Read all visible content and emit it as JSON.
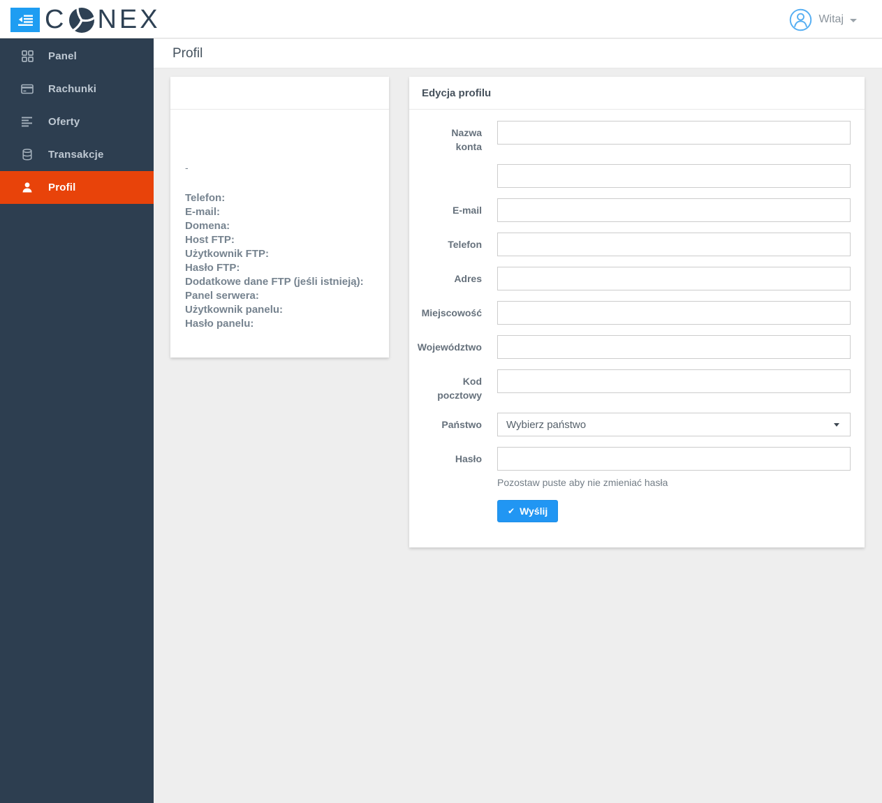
{
  "header": {
    "brand_prefix": "C",
    "brand_suffix": "NEX",
    "greeting": "Witaj"
  },
  "sidebar": {
    "items": [
      {
        "label": "Panel",
        "icon": "grid-icon",
        "active": false
      },
      {
        "label": "Rachunki",
        "icon": "credit-card-icon",
        "active": false
      },
      {
        "label": "Oferty",
        "icon": "list-icon",
        "active": false
      },
      {
        "label": "Transakcje",
        "icon": "database-icon",
        "active": false
      },
      {
        "label": "Profil",
        "icon": "user-icon",
        "active": true
      }
    ]
  },
  "page": {
    "title": "Profil"
  },
  "profile_card": {
    "placeholder_dash": "-",
    "labels": [
      "Telefon:",
      "E-mail:",
      "Domena:",
      "Host FTP:",
      "Użytkownik FTP:",
      "Hasło FTP:",
      "Dodatkowe dane FTP (jeśli istnieją):",
      "Panel serwera:",
      "Użytkownik panelu:",
      "Hasło panelu:"
    ]
  },
  "edit_card": {
    "title": "Edycja profilu",
    "rows": [
      {
        "label": "Nazwa\nkonta",
        "type": "text"
      },
      {
        "label": "",
        "type": "text"
      },
      {
        "label": "E-mail",
        "type": "text"
      },
      {
        "label": "Telefon",
        "type": "text"
      },
      {
        "label": "Adres",
        "type": "text"
      },
      {
        "label": "Miejscowość",
        "type": "text"
      },
      {
        "label": "Województwo",
        "type": "text"
      },
      {
        "label": "Kod\npocztowy",
        "type": "text"
      },
      {
        "label": "Państwo",
        "type": "select",
        "select_value": "Wybierz państwo"
      },
      {
        "label": "Hasło",
        "type": "password",
        "help": "Pozostaw puste aby nie zmieniać hasła"
      }
    ],
    "submit_label": "Wyślij",
    "submit_icon": "check-icon"
  },
  "colors": {
    "sidebar_bg": "#2d3e50",
    "active_orange": "#e8430a",
    "toggle_blue": "#1e9df2",
    "button_blue": "#2196f3",
    "content_bg": "#eeeeee",
    "brand_navy": "#2e4154"
  }
}
